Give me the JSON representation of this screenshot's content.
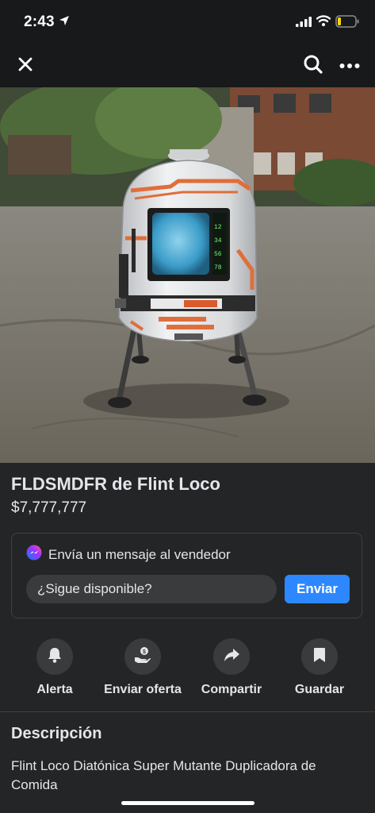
{
  "status_bar": {
    "time": "2:43"
  },
  "nav": {
    "icons": [
      "close-icon",
      "search-icon",
      "more-icon"
    ]
  },
  "listing": {
    "title": "FLDSMDFR de Flint Loco",
    "price": "$7,777,777"
  },
  "message": {
    "header": "Envía un mensaje al vendedor",
    "input_value": "¿Sigue disponible?",
    "send_label": "Enviar"
  },
  "actions": [
    {
      "label": "Alerta",
      "icon": "bell-icon"
    },
    {
      "label": "Enviar oferta",
      "icon": "offer-icon"
    },
    {
      "label": "Compartir",
      "icon": "share-icon"
    },
    {
      "label": "Guardar",
      "icon": "bookmark-icon"
    }
  ],
  "description": {
    "title": "Descripción",
    "body": "Flint Loco Diatónica Super Mutante Duplicadora de Comida"
  },
  "colors": {
    "background": "#242526",
    "bar_background": "#18191a",
    "accent": "#2d88ff",
    "button_gray": "#3a3b3c"
  }
}
